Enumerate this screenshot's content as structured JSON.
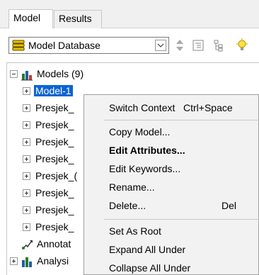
{
  "tabs": [
    {
      "label": "Model",
      "active": true
    },
    {
      "label": "Results",
      "active": false
    }
  ],
  "toolbar": {
    "db_label": "Model Database",
    "icons": [
      "database-icon",
      "chevron-down-icon",
      "up-down-arrows-icon",
      "tree-view-icon",
      "hierarchy-icon",
      "lightbulb-icon"
    ]
  },
  "tree": {
    "root_label": "Models (9)",
    "items": [
      {
        "label": "Model-1",
        "selected": true
      },
      {
        "label": "Presjek_"
      },
      {
        "label": "Presjek_"
      },
      {
        "label": "Presjek_"
      },
      {
        "label": "Presjek_"
      },
      {
        "label": "Presjek_("
      },
      {
        "label": "Presjek_"
      },
      {
        "label": "Presjek_"
      },
      {
        "label": "Presjek_"
      }
    ],
    "annotations_label": "Annotat",
    "analysis_label": "Analysi"
  },
  "context_menu": {
    "items": [
      {
        "label": "Switch Context",
        "shortcut": "Ctrl+Space",
        "bold": false
      },
      {
        "label": "Copy Model...",
        "bold": false
      },
      {
        "label": "Edit Attributes...",
        "bold": true
      },
      {
        "label": "Edit Keywords...",
        "bold": false
      },
      {
        "label": "Rename...",
        "bold": false
      },
      {
        "label": "Delete...",
        "shortcut": "Del",
        "bold": false
      },
      {
        "label": "Set As Root",
        "bold": false
      },
      {
        "label": "Expand All Under",
        "bold": false
      },
      {
        "label": "Collapse All Under",
        "bold": false
      }
    ]
  },
  "colors": {
    "selection": "#0a64d2",
    "menu_bg": "#f2f2f2"
  }
}
